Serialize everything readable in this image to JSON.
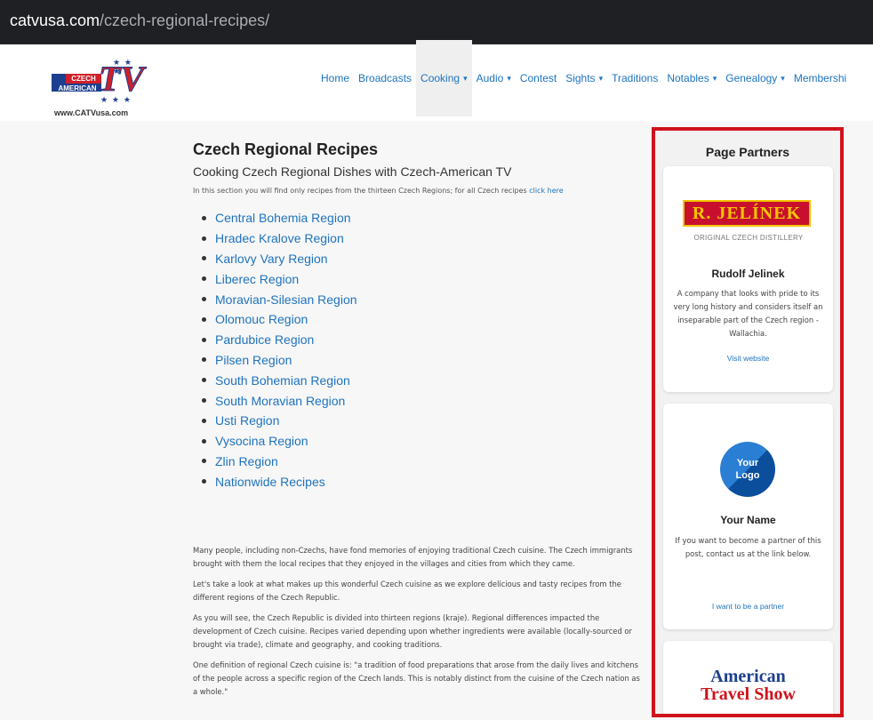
{
  "browser": {
    "url_domain": "catvusa.com",
    "url_path": "/czech-regional-recipes/"
  },
  "header": {
    "logo": {
      "czech": "CZECH",
      "american": "AMERICAN",
      "tv": "TV",
      "site": "www.CATVusa.com"
    },
    "nav": [
      {
        "label": "Home",
        "dropdown": false
      },
      {
        "label": "Broadcasts",
        "dropdown": false
      },
      {
        "label": "Cooking",
        "dropdown": true,
        "active": true
      },
      {
        "label": "Audio",
        "dropdown": true
      },
      {
        "label": "Contest",
        "dropdown": false
      },
      {
        "label": "Sights",
        "dropdown": true
      },
      {
        "label": "Traditions",
        "dropdown": false
      },
      {
        "label": "Notables",
        "dropdown": true
      },
      {
        "label": "Genealogy",
        "dropdown": true
      },
      {
        "label": "Membershi",
        "dropdown": false
      }
    ]
  },
  "main": {
    "title": "Czech Regional Recipes",
    "subtitle": "Cooking Czech Regional Dishes with Czech-American TV",
    "note_text": "In this section you will find only recipes from the thirteen Czech Regions; for all Czech recipes ",
    "note_link": "click here",
    "regions": [
      "Central Bohemia Region",
      "Hradec Kralove Region",
      "Karlovy Vary Region",
      "Liberec Region",
      "Moravian-Silesian Region",
      "Olomouc Region",
      "Pardubice Region",
      "Pilsen Region",
      "South Bohemian Region",
      "South Moravian Region",
      "Usti Region",
      "Vysocina Region",
      "Zlin Region",
      "Nationwide Recipes"
    ],
    "paragraphs": [
      "Many people, including non-Czechs, have fond memories of enjoying traditional Czech cuisine. The Czech immigrants brought with them the local recipes that they enjoyed in the villages and cities from which they came.",
      "Let's take a look at what makes up this wonderful Czech cuisine as we explore delicious and tasty recipes from the different regions of the Czech Republic.",
      "As you will see, the Czech Republic is divided into thirteen regions (kraje). Regional differences impacted the development of Czech cuisine. Recipes varied depending upon whether ingredients were available (locally-sourced or brought via trade), climate and geography, and cooking traditions.",
      "One definition of regional Czech cuisine is: \"a tradition of food preparations that arose from the daily lives and kitchens of the people across a specific region of the Czech lands. This is notably distinct from the cuisine of the Czech nation as a whole.\""
    ]
  },
  "sidebar": {
    "title": "Page Partners",
    "partner1": {
      "logo_text": "R. JELÍNEK",
      "logo_sub": "ORIGINAL CZECH DISTILLERY",
      "name": "Rudolf Jelinek",
      "desc": "A company that looks with pride to its very long history and considers itself an inseparable part of the Czech region - Wallachia.",
      "link": "Visit website"
    },
    "partner2": {
      "logo_text_1": "Your",
      "logo_text_2": "Logo",
      "name": "Your Name",
      "desc": "If you want to become a partner of this post, contact us at the link below.",
      "link": "I want to be a partner"
    },
    "partner3": {
      "logo_line1": "American",
      "logo_line2": "Travel Show"
    }
  }
}
